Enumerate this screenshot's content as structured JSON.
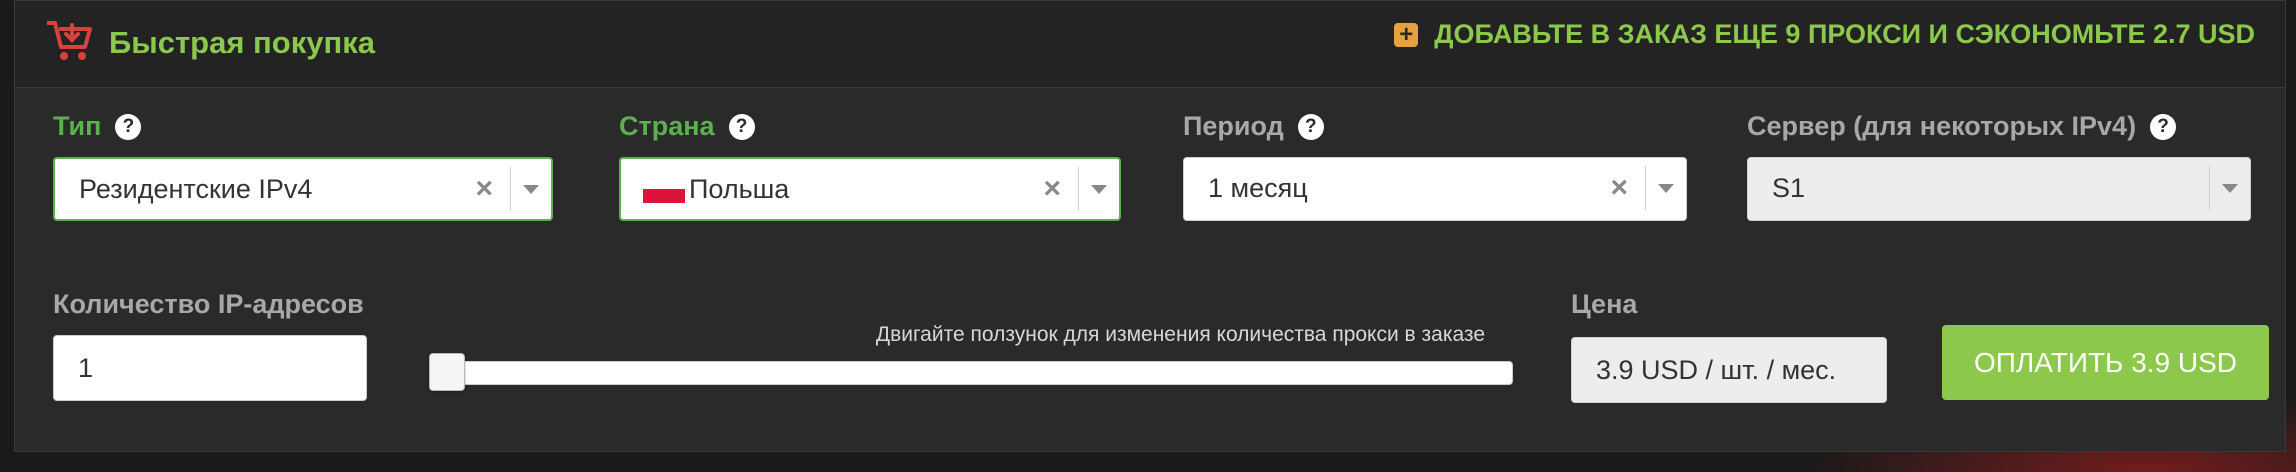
{
  "header": {
    "title": "Быстрая покупка",
    "promo": "ДОБАВЬТЕ В ЗАКАЗ ЕЩЕ 9 ПРОКСИ И СЭКОНОМЬТЕ 2.7 USD",
    "promo_icon": "plus-square-icon",
    "cart_icon": "shopping-cart-icon"
  },
  "fields": {
    "type": {
      "label": "Тип",
      "value": "Резидентские IPv4",
      "help_icon": "?"
    },
    "country": {
      "label": "Страна",
      "value": "Польша",
      "flag": "poland-flag"
    },
    "period": {
      "label": "Период",
      "value": "1 месяц",
      "help_icon": "?"
    },
    "server": {
      "label": "Сервер (для некоторых IPv4)",
      "value": "S1",
      "help_icon": "?"
    }
  },
  "clear_symbol": "×",
  "quantity": {
    "label": "Количество IP-адресов",
    "value": "1",
    "slider_hint": "Двигайте ползунок для изменения количества прокси в заказе",
    "slider_level": 0
  },
  "price": {
    "label": "Цена",
    "value": "3.9 USD / шт. / мес."
  },
  "pay_button": "ОПЛАТИТЬ 3.9 USD",
  "colors": {
    "accent_green": "#8cc84b",
    "label_green": "#5bb14d",
    "promo_icon": "#e6a23c",
    "cart_red": "#d9413f"
  }
}
